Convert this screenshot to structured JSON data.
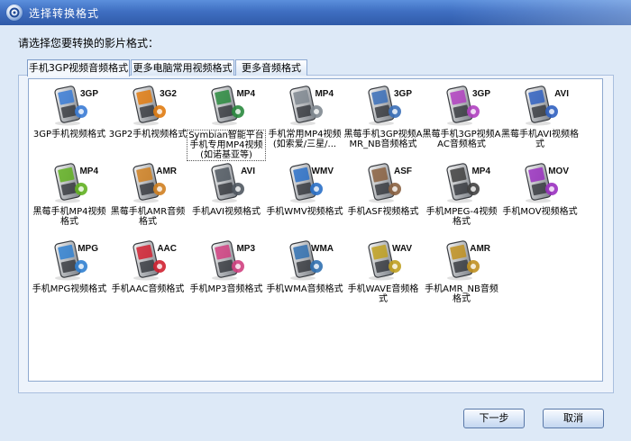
{
  "window": {
    "title": "选择转换格式"
  },
  "prompt": "请选择您要转换的影片格式：",
  "tabs": [
    {
      "label": "手机3GP视频音频格式"
    },
    {
      "label": "更多电脑常用视频格式"
    },
    {
      "label": "更多音频格式"
    }
  ],
  "formats": [
    {
      "label": "3GP手机视频格式",
      "badge": "3GP",
      "icon": "phone-3gp-icon",
      "color": "#3a7bd5"
    },
    {
      "label": "3GP2手机视频格式",
      "badge": "3G2",
      "icon": "phone-3g2-icon",
      "color": "#e07b10"
    },
    {
      "label": "Symbian智能平台手机专用MP4视频(如诺基亚等)",
      "badge": "MP4",
      "icon": "phone-mp4-icon",
      "color": "#2a8a3e"
    },
    {
      "label": "手机常用MP4视频(如索爱/三星/...",
      "badge": "MP4",
      "icon": "phone-mp4-flip-icon",
      "color": "#808890"
    },
    {
      "label": "黑莓手机3GP视频AMR_NB音频格式",
      "badge": "3GP",
      "icon": "blackberry-3gp-icon",
      "color": "#3a6fb8"
    },
    {
      "label": "黑莓手机3GP视频AAC音频格式",
      "badge": "3GP",
      "icon": "blackberry-aac-icon",
      "color": "#b040c0"
    },
    {
      "label": "黑莓手机AVI视频格式",
      "badge": "AVI",
      "icon": "blackberry-avi-icon",
      "color": "#3060c0"
    },
    {
      "label": "黑莓手机MP4视频格式",
      "badge": "MP4",
      "icon": "blackberry-mp4-icon",
      "color": "#60b020"
    },
    {
      "label": "黑莓手机AMR音频格式",
      "badge": "AMR",
      "icon": "blackberry-amr-icon",
      "color": "#d08020"
    },
    {
      "label": "手机AVI视频格式",
      "badge": "AVI",
      "icon": "phone-avi-icon",
      "color": "#505860"
    },
    {
      "label": "手机WMV视频格式",
      "badge": "WMV",
      "icon": "phone-wmv-icon",
      "color": "#2a70c8"
    },
    {
      "label": "手机ASF视频格式",
      "badge": "ASF",
      "icon": "phone-asf-icon",
      "color": "#8a6040"
    },
    {
      "label": "手机MPEG-4视频格式",
      "badge": "MP4",
      "icon": "phone-mpeg4-icon",
      "color": "#404040"
    },
    {
      "label": "手机MOV视频格式",
      "badge": "MOV",
      "icon": "phone-mov-icon",
      "color": "#9a30c0"
    },
    {
      "label": "手机MPG视频格式",
      "badge": "MPG",
      "icon": "phone-mpg-icon",
      "color": "#3080d0"
    },
    {
      "label": "手机AAC音频格式",
      "badge": "AAC",
      "icon": "phone-aac-icon",
      "color": "#d02030"
    },
    {
      "label": "手机MP3音频格式",
      "badge": "MP3",
      "icon": "phone-mp3-icon",
      "color": "#d04080"
    },
    {
      "label": "手机WMA音频格式",
      "badge": "WMA",
      "icon": "phone-wma-icon",
      "color": "#3070b0"
    },
    {
      "label": "手机WAVE音频格式",
      "badge": "WAV",
      "icon": "phone-wave-icon",
      "color": "#c0a020"
    },
    {
      "label": "手机AMR_NB音频格式",
      "badge": "AMR",
      "icon": "phone-amr-icon",
      "color": "#c09020"
    }
  ],
  "buttons": {
    "next": "下一步",
    "cancel": "取消"
  }
}
